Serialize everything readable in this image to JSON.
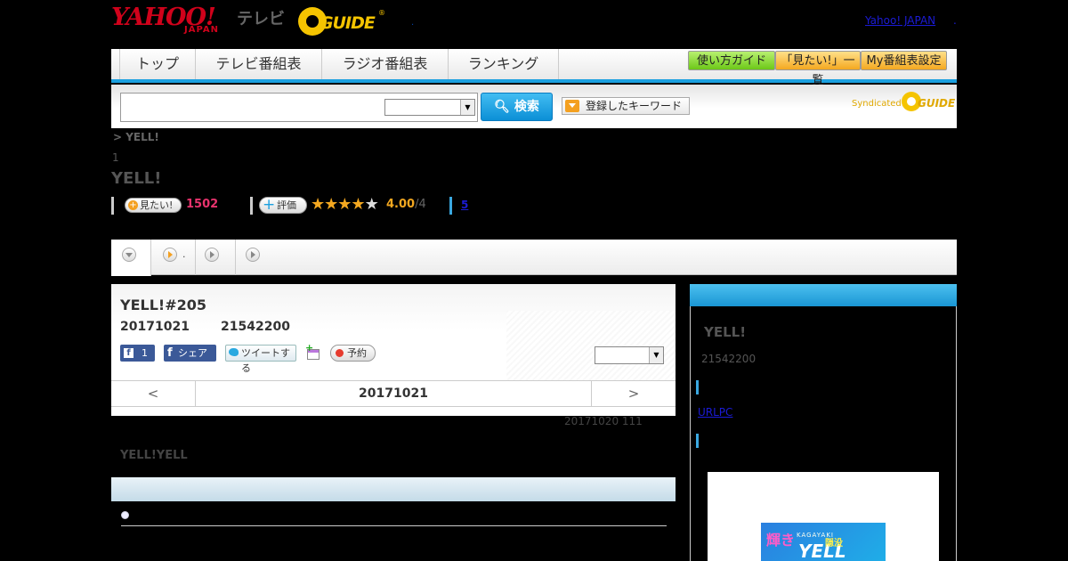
{
  "header": {
    "yahoo_logo": "YAHOO!",
    "yahoo_sub": "JAPAN",
    "tv_label": "テレビ",
    "gguide_logo": "GUIDE",
    "dot": ".",
    "yahoo_japan_link": "Yahoo! JAPAN",
    "link_dot": "."
  },
  "nav": {
    "tabs": [
      "トップ",
      "テレビ番組表",
      "ラジオ番組表",
      "ランキング"
    ],
    "buttons": [
      "使い方ガイド",
      "「見たい!」一覧",
      "My番組表設定"
    ]
  },
  "search": {
    "placeholder": "",
    "select_value": "",
    "button_label": "検索",
    "keyword_label": "登録したキーワード",
    "syndicated": "Syndicated",
    "brand": "GUIDE"
  },
  "program": {
    "breadcrumb": "> YELL!",
    "count": "1",
    "title": "YELL!",
    "mitai_label": "見たい!",
    "mitai_count": "1502",
    "hyoka_label": "評価",
    "rating": 4,
    "rating_max": 5,
    "score": "4.00",
    "score_max": "/4",
    "reviews": "5"
  },
  "subtabs": {
    "second_label": "."
  },
  "episode": {
    "title": "YELL!#205",
    "date": "20171021",
    "time": "21542200",
    "like_count": "1",
    "share_label": "シェア",
    "tweet_label": "ツイートする",
    "reserve_label": "予約",
    "select_value": "",
    "pager_prev": "<",
    "pager_date": "20171021",
    "pager_next": ">",
    "updated": "20171020  111",
    "description": "YELL!YELL"
  },
  "sidebar": {
    "title": "YELL!",
    "time": "21542200",
    "url_label": "URLPC",
    "image_text_1": "輝き",
    "image_text_2": "KAGAYAKI",
    "image_text_3": "YELL",
    "image_text_4": "隠没"
  },
  "colors": {
    "accent": "#1aa0e0",
    "yahoo_red": "#d0021b",
    "gguide_yellow": "#f5c400",
    "mitai_pink": "#e8336d",
    "star_orange": "#f4a820",
    "link_blue": "#1b1bd6"
  }
}
